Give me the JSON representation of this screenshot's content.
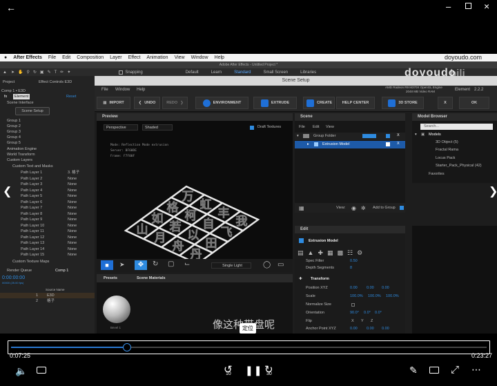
{
  "player": {
    "back_icon": "arrow-left",
    "win_controls": [
      "minimize",
      "maximize",
      "close"
    ],
    "time_current": "0:07:25",
    "time_total": "0:23:27",
    "progress_fraction": 0.244,
    "tooltip": "定位",
    "skip_back": "10",
    "skip_forward": "30",
    "watermark": "doyoudo",
    "watermark_url": "doyoudo.com",
    "subtitle": "像这种带盘呢"
  },
  "mac_menu": {
    "app": "After Effects",
    "items": [
      "File",
      "Edit",
      "Composition",
      "Layer",
      "Effect",
      "Animation",
      "View",
      "Window",
      "Help"
    ]
  },
  "ae": {
    "window_title": "Adobe After Effects - Untitled Project *",
    "snapping": "Snapping",
    "workspaces": [
      "Default",
      "Learn",
      "Standard",
      "Small Screen",
      "Libraries"
    ],
    "active_workspace": "Standard",
    "project_tab": "Project",
    "effect_controls_tab": "Effect Controls E3D",
    "comp_label": "Comp 1 • E3D",
    "element_label": "Element",
    "reset": "Reset",
    "scene_interface": "Scene Interface",
    "scene_setup_btn": "Scene Setup",
    "groups": [
      "Group 1",
      "Group 2",
      "Group 3",
      "Group 4",
      "Group 5"
    ],
    "animation_engine": "Animation Engine",
    "world_transform": "World Transform",
    "custom_layers": "Custom Layers",
    "custom_text_masks": "Custom Text and Masks",
    "path_layers": [
      {
        "name": "Path Layer 1",
        "value": "3. 格子"
      },
      {
        "name": "Path Layer 2",
        "value": "None"
      },
      {
        "name": "Path Layer 3",
        "value": "None"
      },
      {
        "name": "Path Layer 4",
        "value": "None"
      },
      {
        "name": "Path Layer 5",
        "value": "None"
      },
      {
        "name": "Path Layer 6",
        "value": "None"
      },
      {
        "name": "Path Layer 7",
        "value": "None"
      },
      {
        "name": "Path Layer 8",
        "value": "None"
      },
      {
        "name": "Path Layer 9",
        "value": "None"
      },
      {
        "name": "Path Layer 10",
        "value": "None"
      },
      {
        "name": "Path Layer 11",
        "value": "None"
      },
      {
        "name": "Path Layer 12",
        "value": "None"
      },
      {
        "name": "Path Layer 13",
        "value": "None"
      },
      {
        "name": "Path Layer 14",
        "value": "None"
      },
      {
        "name": "Path Layer 15",
        "value": "None"
      }
    ],
    "custom_texture_maps": "Custom Texture Maps",
    "render_queue": "Render Queue",
    "comp_tab": "Comp 1",
    "timecode": "0:00:00:00",
    "fps": "00000 (25.00 fps)",
    "source_name_header": "Source Name",
    "layers": [
      {
        "num": "1",
        "name": "E3D"
      },
      {
        "num": "2",
        "name": "格子"
      }
    ]
  },
  "scene_setup": {
    "title": "Scene Setup",
    "menu": [
      "File",
      "Window",
      "Help"
    ],
    "gpu_line1": "AMD Radeon R9 M370X OpenGL Engine",
    "gpu_line2": "2048 MB Video RAM",
    "element_version_label": "Element",
    "element_version": "2.2.2",
    "toolbar": {
      "import": "IMPORT",
      "undo": "UNDO",
      "redo": "REDO",
      "environment": "ENVIRONMENT",
      "extrude": "EXTRUDE",
      "create": "CREATE",
      "help_center": "HELP CENTER",
      "store": "3D STORE",
      "x": "X",
      "ok": "OK"
    },
    "preview": {
      "title": "Preview",
      "camera": "Perspective",
      "shading": "Shaded",
      "draft_textures": "Draft Textures",
      "info": [
        "Mode: Reflection Mode extrusion",
        "Server: BF60DE",
        "Frame: F7F00F"
      ],
      "light": "Single Light"
    },
    "scene": {
      "title": "Scene",
      "menu": [
        "File",
        "Edit",
        "View"
      ],
      "group_folder": "Group Folder",
      "extrusion_model": "Extrusion Model",
      "view_label": "View:",
      "add_to_group": "Add to Group"
    },
    "model_browser": {
      "title": "Model Browser",
      "search_placeholder": "Search...",
      "models_root": "Models",
      "items": [
        "3D Object (5)",
        "Fractal Rama",
        "Locus Pack",
        "Starter_Pack_Physical (42)"
      ],
      "favorites": "Favorites"
    },
    "presets": {
      "tab": "Presets",
      "scene_materials_tab": "Scene Materials",
      "bevel_label": "Bevel 1"
    },
    "edit": {
      "title": "Edit",
      "header": "Extrusion Model",
      "spec_filter": "Spec Filter",
      "spec_filter_val": "0.50",
      "depth_segments": "Depth Segments",
      "depth_segments_val": "8",
      "transform": "Transform",
      "position": "Position XYZ",
      "position_val": [
        "0.00",
        "0.00",
        "0.00"
      ],
      "scale": "Scale",
      "scale_val": [
        "100.0%",
        "100.0%",
        "100.0%"
      ],
      "normalize_size": "Normalize Size",
      "orientation": "Orientation",
      "orientation_val": [
        "90.0°",
        "0.0°",
        "0.0°"
      ],
      "flip": "Flip",
      "flip_axes": [
        "X",
        "Y",
        "Z"
      ],
      "anchor_point": "Anchor Point XYZ",
      "anchor_val": [
        "0.00",
        "0.00",
        "0.00"
      ]
    }
  },
  "chars": [
    "万",
    "虹",
    "丰",
    "我",
    "格",
    "柯",
    "自",
    "飞",
    "如",
    "若",
    "以",
    "田",
    "山",
    "月",
    "舟",
    "丹"
  ]
}
